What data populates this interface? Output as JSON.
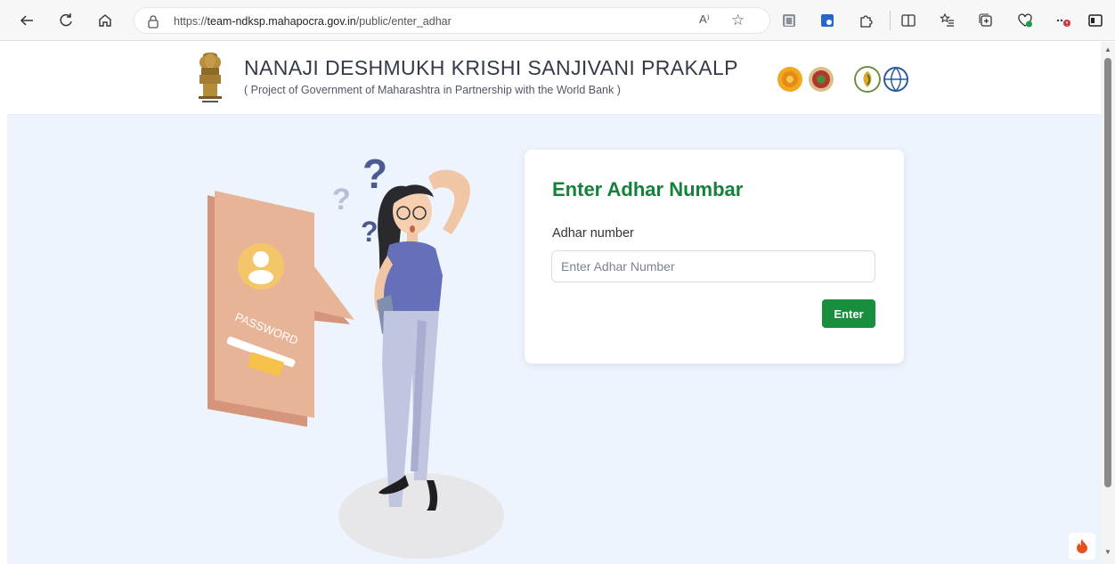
{
  "browser": {
    "url_prefix": "https://",
    "url_host": "team-ndksp.mahapocra.gov.in",
    "url_path": "/public/enter_adhar",
    "read_aloud_label": "A⁾",
    "icons": [
      "back-icon",
      "refresh-icon",
      "home-icon",
      "lock-icon",
      "read-aloud-icon",
      "favorite-star-icon",
      "extension-icon",
      "extension-icon",
      "extensions-puzzle-icon",
      "split-screen-icon",
      "favorites-list-icon",
      "collections-icon",
      "health-icon",
      "more-icon",
      "sidebar-icon"
    ]
  },
  "header": {
    "title": "NANAJI DESHMUKH KRISHI SANJIVANI PRAKALP",
    "subtitle": "( Project of Government of Maharashtra in Partnership with the World Bank )"
  },
  "form": {
    "title": "Enter Adhar Numbar",
    "field_label": "Adhar number",
    "placeholder": "Enter Adhar Number",
    "value": "",
    "button_label": "Enter"
  },
  "colors": {
    "accent_green": "#15813a",
    "button_green": "#198f3d",
    "page_bg": "#eef4fd"
  }
}
